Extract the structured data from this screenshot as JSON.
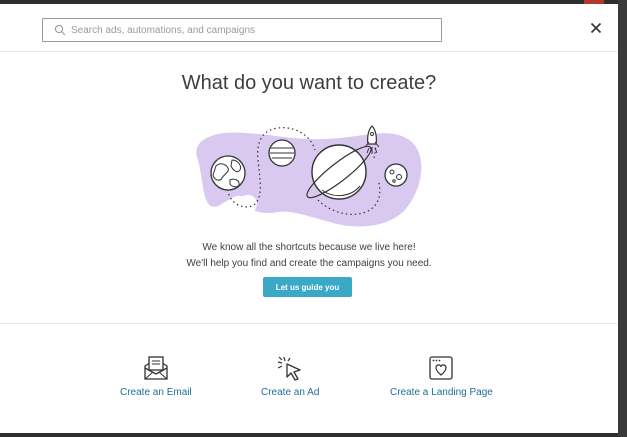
{
  "search": {
    "placeholder": "Search ads, automations, and campaigns",
    "value": ""
  },
  "modal": {
    "title": "What do you want to create?",
    "description_line1": "We know all the shortcuts because we live here!",
    "description_line2": "We'll help you find and create the campaigns you need.",
    "cta_label": "Let us guide you"
  },
  "options": [
    {
      "label": "Create an Email",
      "icon": "email-envelope-icon"
    },
    {
      "label": "Create an Ad",
      "icon": "cursor-click-icon"
    },
    {
      "label": "Create a Landing Page",
      "icon": "landing-page-icon"
    }
  ],
  "colors": {
    "accent": "#3ba8c8",
    "link": "#1e6f9c",
    "blob": "#d9c9f0",
    "title_text": "#3e3e3e"
  }
}
